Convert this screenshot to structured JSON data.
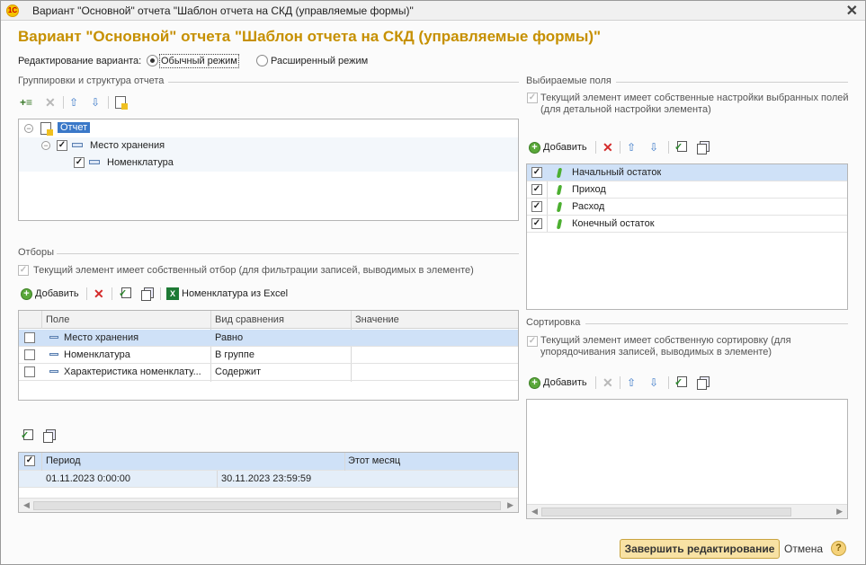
{
  "window": {
    "title": "Вариант \"Основной\" отчета \"Шаблон отчета на СКД (управляемые формы)\"",
    "heading": "Вариант \"Основной\" отчета \"Шаблон отчета на СКД (управляемые формы)\""
  },
  "mode": {
    "label": "Редактирование варианта:",
    "options": [
      "Обычный режим",
      "Расширенный режим"
    ],
    "selected": "Обычный режим"
  },
  "groupings": {
    "title": "Группировки и структура отчета",
    "tree": [
      {
        "label": "Отчет",
        "level": 0,
        "checked": null
      },
      {
        "label": "Место хранения",
        "level": 1,
        "checked": true
      },
      {
        "label": "Номенклатура",
        "level": 2,
        "checked": true
      }
    ]
  },
  "filters": {
    "title": "Отборы",
    "own_filter_note": "Текущий элемент имеет собственный отбор (для фильтрации записей, выводимых в элементе)",
    "toolbar": {
      "add": "Добавить",
      "from_excel": "Номенклатура из Excel"
    },
    "columns": [
      "Поле",
      "Вид сравнения",
      "Значение"
    ],
    "rows": [
      {
        "field": "Место хранения",
        "comparison": "Равно",
        "value": "",
        "checked": false
      },
      {
        "field": "Номенклатура",
        "comparison": "В группе",
        "value": "",
        "checked": false
      },
      {
        "field": "Характеристика номенклату...",
        "comparison": "Содержит",
        "value": "",
        "checked": false
      }
    ]
  },
  "params": {
    "rows": [
      {
        "name": "Период",
        "value": "Этот месяц",
        "from": "01.11.2023 0:00:00",
        "to": "30.11.2023 23:59:59",
        "checked": true
      }
    ]
  },
  "selected_fields": {
    "title": "Выбираемые поля",
    "own_note": "Текущий элемент имеет собственные настройки выбранных полей (для детальной настройки элемента)",
    "toolbar": {
      "add": "Добавить"
    },
    "rows": [
      {
        "label": "Начальный остаток",
        "checked": true
      },
      {
        "label": "Приход",
        "checked": true
      },
      {
        "label": "Расход",
        "checked": true
      },
      {
        "label": "Конечный остаток",
        "checked": true
      }
    ]
  },
  "sorting": {
    "title": "Сортировка",
    "own_note": "Текущий элемент имеет собственную сортировку (для упорядочивания записей, выводимых в элементе)",
    "toolbar": {
      "add": "Добавить"
    }
  },
  "footer": {
    "finish": "Завершить редактирование",
    "cancel": "Отмена",
    "help": "?"
  }
}
